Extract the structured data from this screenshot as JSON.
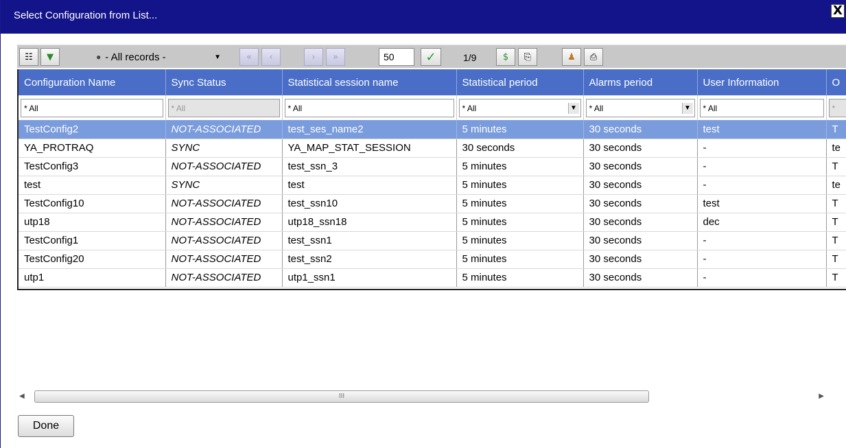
{
  "window": {
    "title": "Select Configuration from List...",
    "close_glyph": "X"
  },
  "toolbar": {
    "filter_select": "- All records -",
    "page_size": "50",
    "page_count": "1/9"
  },
  "table": {
    "columns": [
      "Configuration Name",
      "Sync Status",
      "Statistical session name",
      "Statistical period",
      "Alarms period",
      "User Information",
      "O"
    ],
    "filters": [
      "* All",
      "* All",
      "* All",
      "* All",
      "* All",
      "* All",
      "*"
    ],
    "rows": [
      {
        "name": "TestConfig2",
        "sync": "NOT-ASSOCIATED",
        "session": "test_ses_name2",
        "stat_period": "5 minutes",
        "alarm_period": "30 seconds",
        "user_info": "test",
        "other": "T",
        "selected": true
      },
      {
        "name": "YA_PROTRAQ",
        "sync": "SYNC",
        "session": "YA_MAP_STAT_SESSION",
        "stat_period": "30 seconds",
        "alarm_period": "30 seconds",
        "user_info": "-",
        "other": "te"
      },
      {
        "name": "TestConfig3",
        "sync": "NOT-ASSOCIATED",
        "session": "test_ssn_3",
        "stat_period": "5 minutes",
        "alarm_period": "30 seconds",
        "user_info": "-",
        "other": "T"
      },
      {
        "name": "test",
        "sync": "SYNC",
        "session": "test",
        "stat_period": "5 minutes",
        "alarm_period": "30 seconds",
        "user_info": "-",
        "other": "te"
      },
      {
        "name": "TestConfig10",
        "sync": "NOT-ASSOCIATED",
        "session": "test_ssn10",
        "stat_period": "5 minutes",
        "alarm_period": "30 seconds",
        "user_info": "test",
        "other": "T"
      },
      {
        "name": "utp18",
        "sync": "NOT-ASSOCIATED",
        "session": "utp18_ssn18",
        "stat_period": "5 minutes",
        "alarm_period": "30 seconds",
        "user_info": "dec",
        "other": "T"
      },
      {
        "name": "TestConfig1",
        "sync": "NOT-ASSOCIATED",
        "session": "test_ssn1",
        "stat_period": "5 minutes",
        "alarm_period": "30 seconds",
        "user_info": "-",
        "other": "T"
      },
      {
        "name": "TestConfig20",
        "sync": "NOT-ASSOCIATED",
        "session": "test_ssn2",
        "stat_period": "5 minutes",
        "alarm_period": "30 seconds",
        "user_info": "-",
        "other": "T"
      },
      {
        "name": "utp1",
        "sync": "NOT-ASSOCIATED",
        "session": "utp1_ssn1",
        "stat_period": "5 minutes",
        "alarm_period": "30 seconds",
        "user_info": "-",
        "other": "T"
      }
    ]
  },
  "scrollbar": {
    "thumb_grip": "III"
  },
  "footer": {
    "done_label": "Done"
  },
  "colors": {
    "titlebar": "#14148a",
    "header": "#4a6ec8",
    "selected_row": "#7a9cdc"
  }
}
